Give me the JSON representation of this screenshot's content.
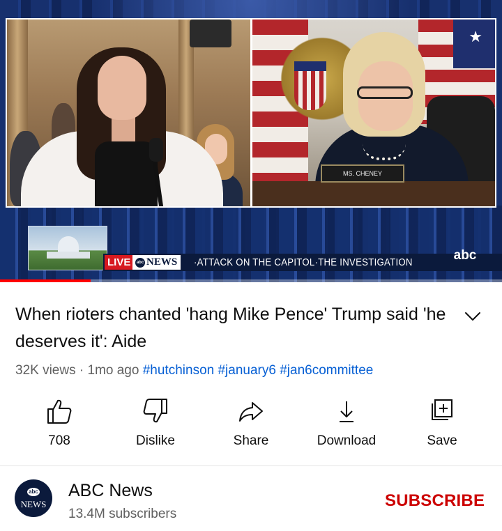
{
  "video": {
    "nameplate": "MS. CHENEY",
    "ticker": {
      "live": "LIVE",
      "brand": "NEWS",
      "brand_mark": "abc",
      "headline": "·ATTACK ON THE CAPITOL·THE INVESTIGATION"
    },
    "network_logo": "abc",
    "progress_fraction": 0.18
  },
  "title": "When rioters chanted 'hang Mike Pence' Trump said 'he deserves it': Aide",
  "meta": {
    "views": "32K views",
    "separator": " · ",
    "age": "1mo ago",
    "hashtags": [
      "#hutchinson",
      "#january6",
      "#jan6committee"
    ]
  },
  "actions": [
    {
      "label": "708",
      "icon": "thumbs-up-icon"
    },
    {
      "label": "Dislike",
      "icon": "thumbs-down-icon"
    },
    {
      "label": "Share",
      "icon": "share-icon"
    },
    {
      "label": "Download",
      "icon": "download-icon"
    },
    {
      "label": "Save",
      "icon": "save-to-playlist-icon"
    }
  ],
  "channel": {
    "avatar_top": "abc",
    "avatar_bottom": "NEWS",
    "name": "ABC News",
    "subscribers": "13.4M subscribers",
    "subscribe_label": "SUBSCRIBE"
  },
  "colors": {
    "accent_red": "#cc0000",
    "hashtag_blue": "#065fd4",
    "progress_red": "#ff0000"
  }
}
